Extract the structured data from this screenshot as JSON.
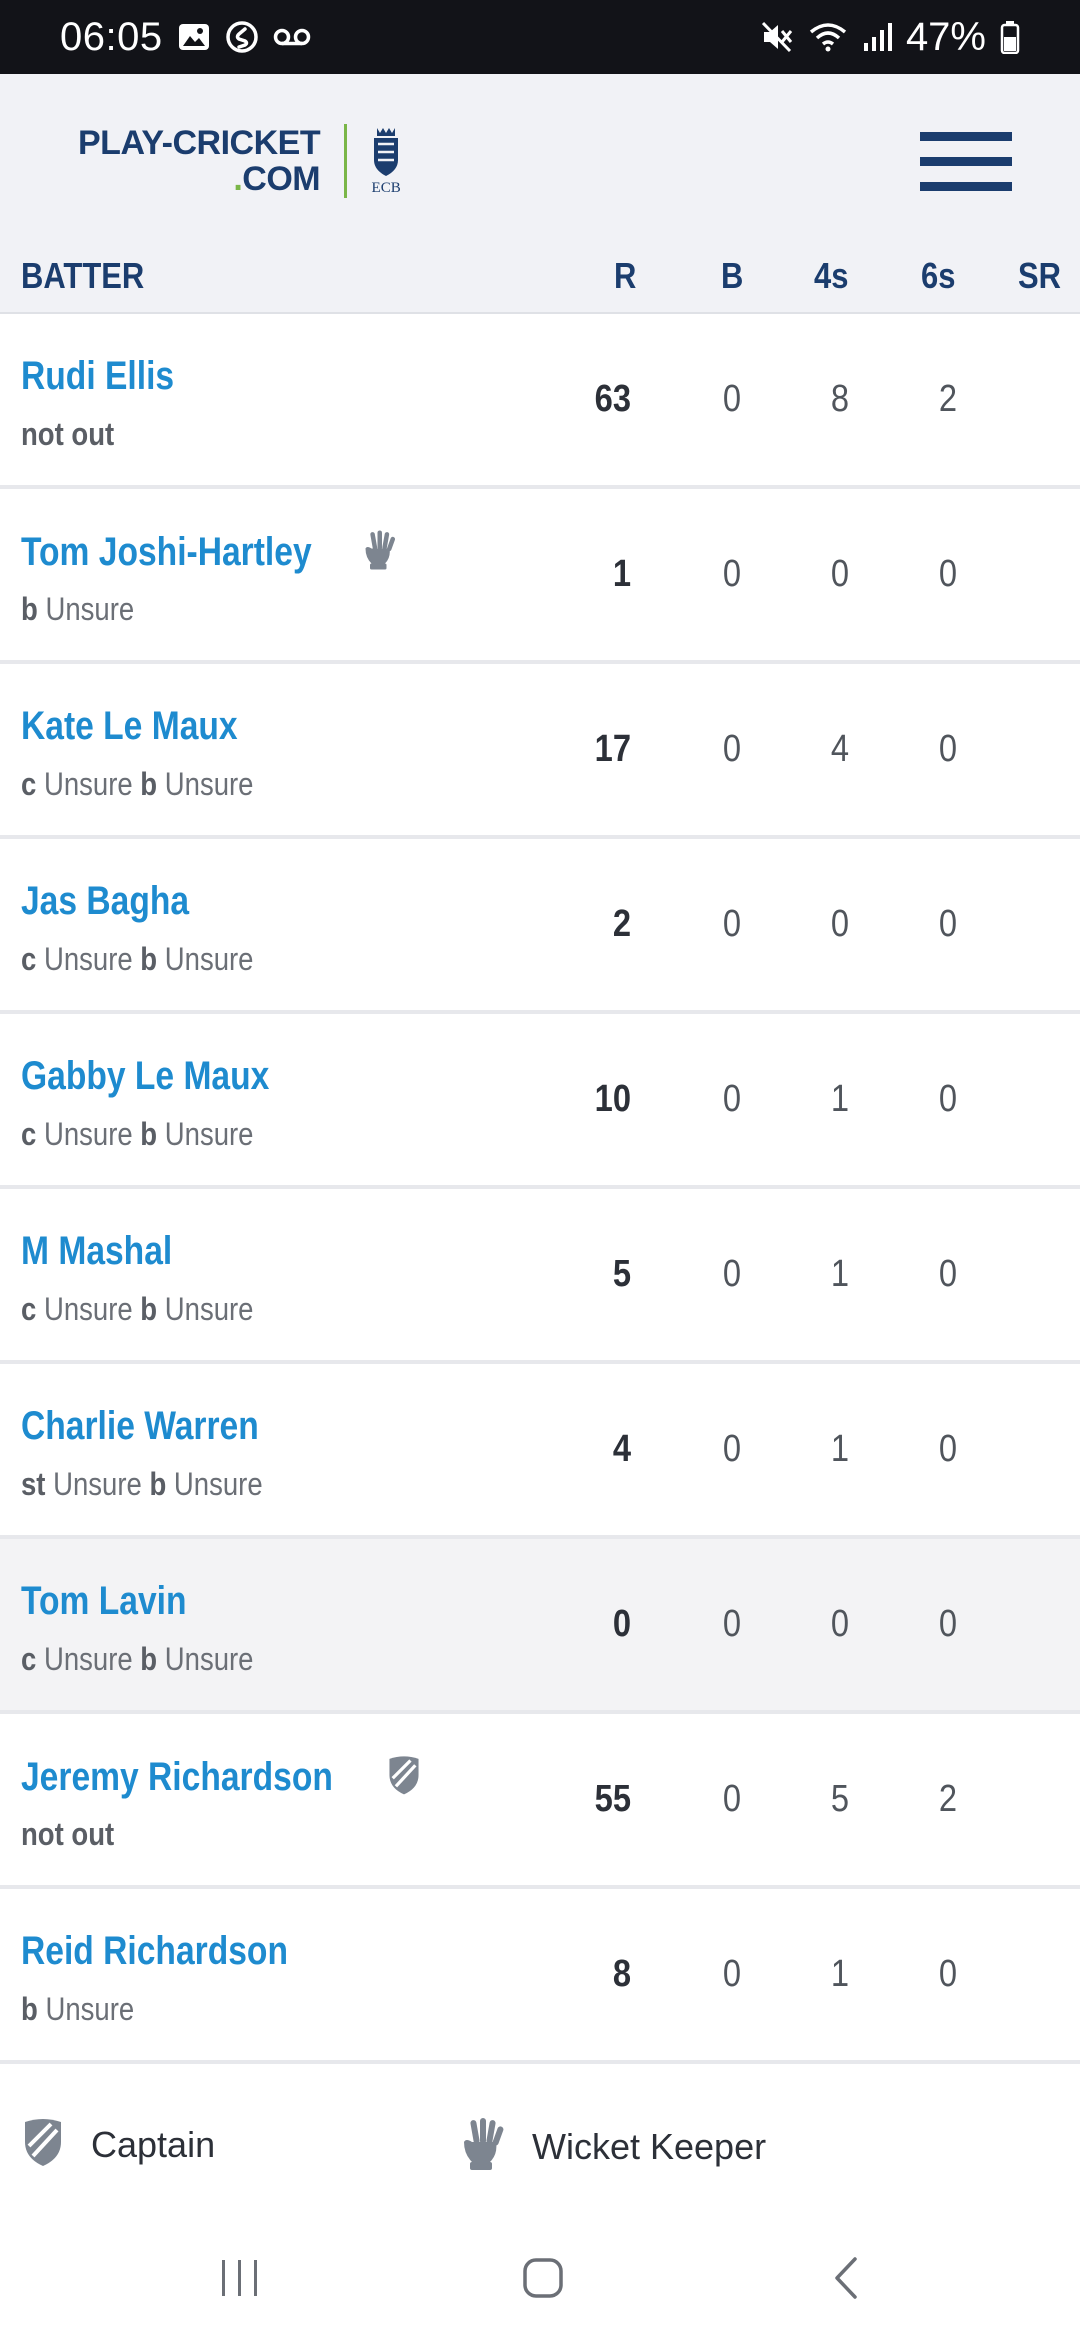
{
  "status_bar": {
    "time": "06:05",
    "battery_percent": "47%",
    "left_icons": [
      "image-icon",
      "shazam-icon",
      "voicemail-icon"
    ],
    "right_icons": [
      "mute-icon",
      "wifi-icon",
      "signal-icon",
      "battery-icon"
    ]
  },
  "header": {
    "logo_line1": "PLAY-CRICKET",
    "logo_dot": ".",
    "logo_line2": "COM",
    "emblem_label": "ECB",
    "menu_icon": "hamburger-menu-icon"
  },
  "table": {
    "columns": {
      "batter": "BATTER",
      "runs": "R",
      "balls": "B",
      "fours": "4s",
      "sixes": "6s",
      "strike_rate": "SR"
    },
    "rows": [
      {
        "name": "Rudi Ellis",
        "role": "",
        "dismissal": [
          {
            "t": "not out",
            "b": true
          }
        ],
        "r": "63",
        "b": "0",
        "fours": "8",
        "sixes": "2",
        "sr": ""
      },
      {
        "name": "Tom Joshi-Hartley",
        "role": "wicket-keeper",
        "dismissal": [
          {
            "t": "b",
            "b": true
          },
          {
            "t": " Unsure",
            "b": false
          }
        ],
        "r": "1",
        "b": "0",
        "fours": "0",
        "sixes": "0",
        "sr": ""
      },
      {
        "name": "Kate Le Maux",
        "role": "",
        "dismissal": [
          {
            "t": "c",
            "b": true
          },
          {
            "t": " Unsure ",
            "b": false
          },
          {
            "t": "b",
            "b": true
          },
          {
            "t": " Unsure",
            "b": false
          }
        ],
        "r": "17",
        "b": "0",
        "fours": "4",
        "sixes": "0",
        "sr": ""
      },
      {
        "name": "Jas Bagha",
        "role": "",
        "dismissal": [
          {
            "t": "c",
            "b": true
          },
          {
            "t": " Unsure ",
            "b": false
          },
          {
            "t": "b",
            "b": true
          },
          {
            "t": " Unsure",
            "b": false
          }
        ],
        "r": "2",
        "b": "0",
        "fours": "0",
        "sixes": "0",
        "sr": ""
      },
      {
        "name": "Gabby Le Maux",
        "role": "",
        "dismissal": [
          {
            "t": "c",
            "b": true
          },
          {
            "t": " Unsure ",
            "b": false
          },
          {
            "t": "b",
            "b": true
          },
          {
            "t": " Unsure",
            "b": false
          }
        ],
        "r": "10",
        "b": "0",
        "fours": "1",
        "sixes": "0",
        "sr": ""
      },
      {
        "name": "M Mashal",
        "role": "",
        "dismissal": [
          {
            "t": "c",
            "b": true
          },
          {
            "t": " Unsure ",
            "b": false
          },
          {
            "t": "b",
            "b": true
          },
          {
            "t": " Unsure",
            "b": false
          }
        ],
        "r": "5",
        "b": "0",
        "fours": "1",
        "sixes": "0",
        "sr": ""
      },
      {
        "name": "Charlie Warren",
        "role": "",
        "dismissal": [
          {
            "t": "st",
            "b": true
          },
          {
            "t": " Unsure ",
            "b": false
          },
          {
            "t": "b",
            "b": true
          },
          {
            "t": " Unsure",
            "b": false
          }
        ],
        "r": "4",
        "b": "0",
        "fours": "1",
        "sixes": "0",
        "sr": ""
      },
      {
        "name": "Tom Lavin",
        "role": "",
        "dismissal": [
          {
            "t": "c",
            "b": true
          },
          {
            "t": " Unsure ",
            "b": false
          },
          {
            "t": "b",
            "b": true
          },
          {
            "t": " Unsure",
            "b": false
          }
        ],
        "r": "0",
        "b": "0",
        "fours": "0",
        "sixes": "0",
        "sr": "",
        "shaded": true
      },
      {
        "name": "Jeremy Richardson",
        "role": "captain",
        "dismissal": [
          {
            "t": "not out",
            "b": true
          }
        ],
        "r": "55",
        "b": "0",
        "fours": "5",
        "sixes": "2",
        "sr": ""
      },
      {
        "name": "Reid Richardson",
        "role": "",
        "dismissal": [
          {
            "t": "b",
            "b": true
          },
          {
            "t": " Unsure",
            "b": false
          }
        ],
        "r": "8",
        "b": "0",
        "fours": "1",
        "sixes": "0",
        "sr": ""
      }
    ]
  },
  "legend": {
    "captain": "Captain",
    "captain_icon": "captain-shield-icon",
    "keeper": "Wicket Keeper",
    "keeper_icon": "wicket-keeper-glove-icon"
  },
  "nav": {
    "recents_icon": "recents-icon",
    "home_icon": "home-icon",
    "back_icon": "back-icon"
  },
  "colors": {
    "brand_navy": "#1b3d6e",
    "brand_green": "#7ab648",
    "name_blue": "#1e8bcf",
    "header_bg": "#f1f2f6",
    "icon_gray": "#7d8590"
  }
}
